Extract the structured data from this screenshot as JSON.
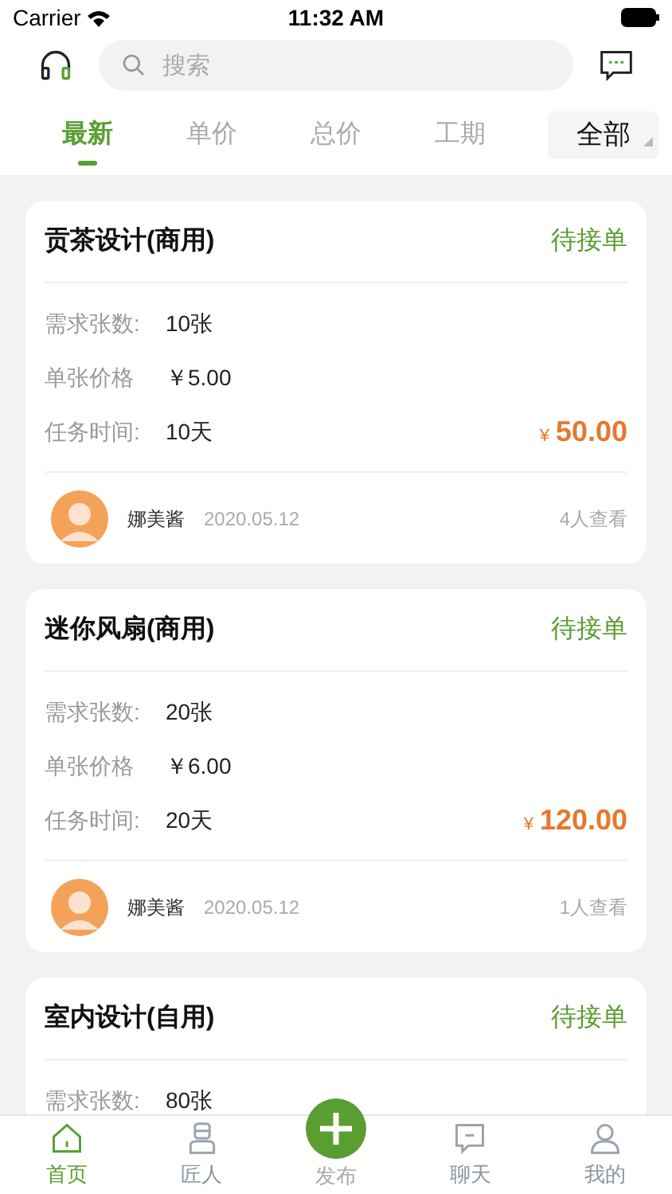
{
  "status_bar": {
    "carrier": "Carrier",
    "time": "11:32 AM"
  },
  "search": {
    "placeholder": "搜索"
  },
  "tabs": [
    {
      "label": "最新",
      "selected": true
    },
    {
      "label": "单价",
      "selected": false
    },
    {
      "label": "总价",
      "selected": false
    },
    {
      "label": "工期",
      "selected": false
    }
  ],
  "filter": {
    "label": "全部"
  },
  "orders": [
    {
      "title": "贡茶设计(商用)",
      "status": "待接单",
      "rows": [
        {
          "label": "需求张数:",
          "value": "10张"
        },
        {
          "label": "单张价格",
          "value": "￥5.00"
        },
        {
          "label": "任务时间:",
          "value": "10天"
        }
      ],
      "currency": "¥",
      "price": "50.00",
      "author": "娜美酱",
      "date": "2020.05.12",
      "views": "4人查看"
    },
    {
      "title": "迷你风扇(商用)",
      "status": "待接单",
      "rows": [
        {
          "label": "需求张数:",
          "value": "20张"
        },
        {
          "label": "单张价格",
          "value": "￥6.00"
        },
        {
          "label": "任务时间:",
          "value": "20天"
        }
      ],
      "currency": "¥",
      "price": "120.00",
      "author": "娜美酱",
      "date": "2020.05.12",
      "views": "1人查看"
    },
    {
      "title": "室内设计(自用)",
      "status": "待接单",
      "rows": [
        {
          "label": "需求张数:",
          "value": "80张"
        }
      ]
    }
  ],
  "nav": [
    {
      "kind": "home",
      "label": "首页",
      "selected": true
    },
    {
      "kind": "worker",
      "label": "匠人",
      "selected": false
    },
    {
      "kind": "publish",
      "label": "发布",
      "selected": false
    },
    {
      "kind": "chat",
      "label": "聊天",
      "selected": false
    },
    {
      "kind": "profile",
      "label": "我的",
      "selected": false
    }
  ]
}
